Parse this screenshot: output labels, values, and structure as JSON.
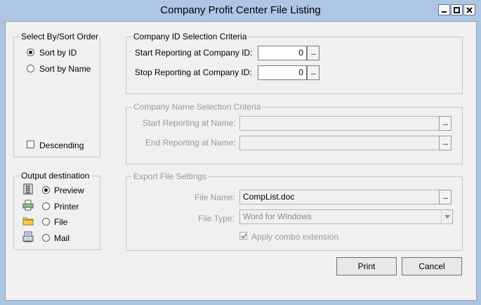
{
  "window": {
    "title": "Company Profit Center File Listing",
    "controls": [
      "minimize-icon",
      "maximize-icon",
      "close-icon"
    ]
  },
  "sort_group": {
    "label": "Select By/Sort Order",
    "options": [
      {
        "label": "Sort by  ID",
        "selected": true
      },
      {
        "label": "Sort by  Name",
        "selected": false
      }
    ],
    "descending_label": "Descending",
    "descending_checked": false
  },
  "company_id_group": {
    "label": "Company ID Selection Criteria",
    "start_label": "Start Reporting at Company ID:",
    "start_value": "0",
    "stop_label": "Stop Reporting at Company  ID:",
    "stop_value": "0",
    "ellipsis": "..."
  },
  "company_name_group": {
    "label": "Company Name Selection Criteria",
    "start_label": "Start Reporting at Name:",
    "start_value": "",
    "end_label": "End Reporting at Name:",
    "end_value": "",
    "ellipsis": "..."
  },
  "output_group": {
    "label": "Output destination",
    "options": [
      {
        "label": "Preview",
        "icon": "preview-icon",
        "selected": true
      },
      {
        "label": "Printer",
        "icon": "printer-icon",
        "selected": false
      },
      {
        "label": "File",
        "icon": "folder-icon",
        "selected": false
      },
      {
        "label": "Mail",
        "icon": "mail-icon",
        "selected": false
      }
    ]
  },
  "export_group": {
    "label": "Export  File Settings",
    "file_name_label": "File Name:",
    "file_name_value": "CompList.doc",
    "file_type_label": "File Type:",
    "file_type_value": "Word for Windows",
    "apply_label": "Apply combo extension",
    "apply_checked": true,
    "ellipsis": "..."
  },
  "buttons": {
    "print": "Print",
    "cancel": "Cancel"
  },
  "colors": {
    "titlebar": "#aec6e4",
    "frame": "#adc4e0",
    "client": "#f0f0f0",
    "disabled_text": "#9a9a9a"
  }
}
